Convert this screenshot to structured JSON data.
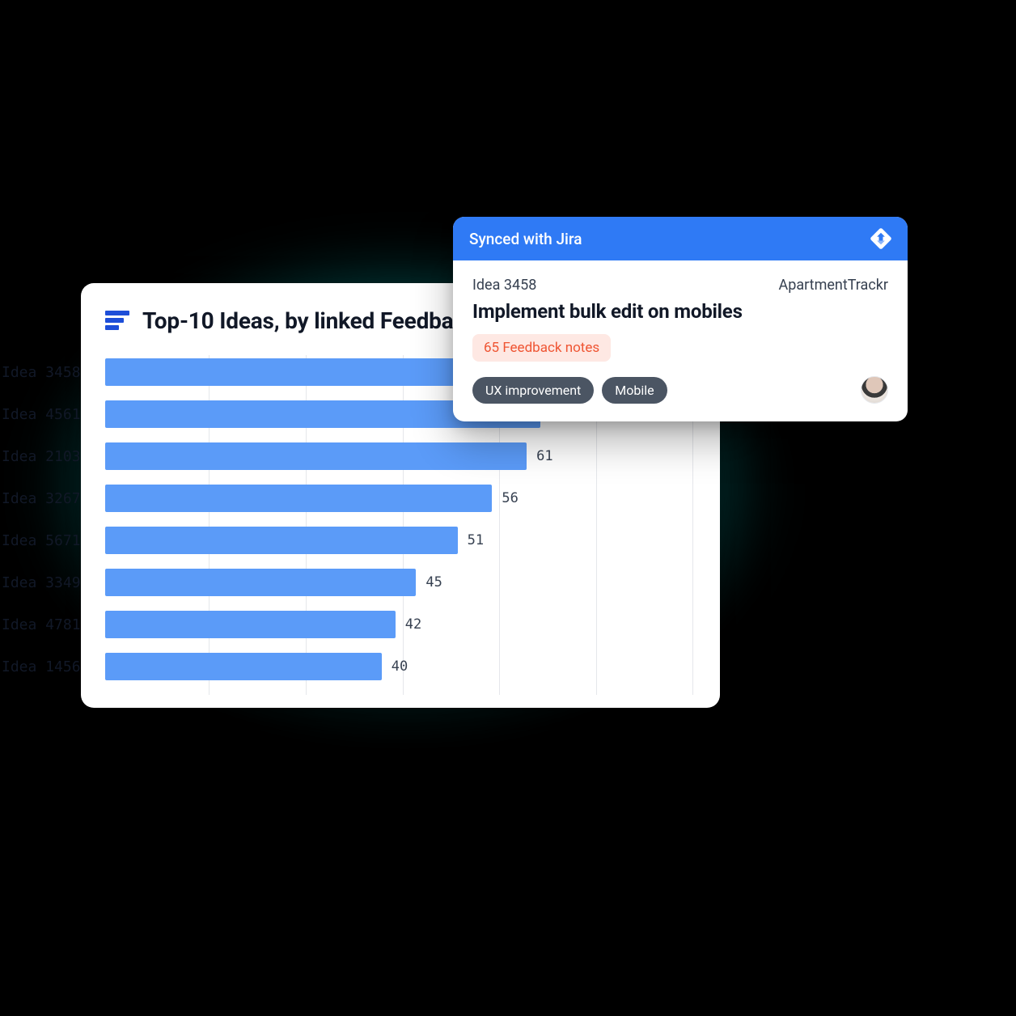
{
  "chart_data": {
    "type": "bar",
    "orientation": "horizontal",
    "title": "Top-10 Ideas, by linked Feedback",
    "xlabel": "",
    "ylabel": "",
    "xlim": [
      0,
      70
    ],
    "grid_x": [
      0,
      14,
      28,
      42,
      56,
      70
    ],
    "categories": [
      "Idea 3458",
      "Idea 4561",
      "Idea 2103",
      "Idea 3267",
      "Idea 5671",
      "Idea 3349",
      "Idea 4781",
      "Idea 1456"
    ],
    "values": [
      65,
      63,
      61,
      56,
      51,
      45,
      42,
      40
    ],
    "value_labels_visible": [
      false,
      false,
      true,
      true,
      true,
      true,
      true,
      true
    ],
    "bar_color": "#5b9bf8"
  },
  "detail": {
    "sync_label": "Synced with Jira",
    "idea_id": "Idea 3458",
    "workspace": "ApartmentTrackr",
    "title": "Implement bulk edit on mobiles",
    "feedback_badge": "65 Feedback notes",
    "tags": [
      "UX improvement",
      "Mobile"
    ]
  },
  "colors": {
    "card_bg": "#ffffff",
    "accent": "#2f7af5",
    "bar": "#5b9bf8",
    "glow": "#00c8c8",
    "badge_bg": "#fee8e3",
    "badge_fg": "#ef5533",
    "tag_bg": "#4b5563"
  }
}
